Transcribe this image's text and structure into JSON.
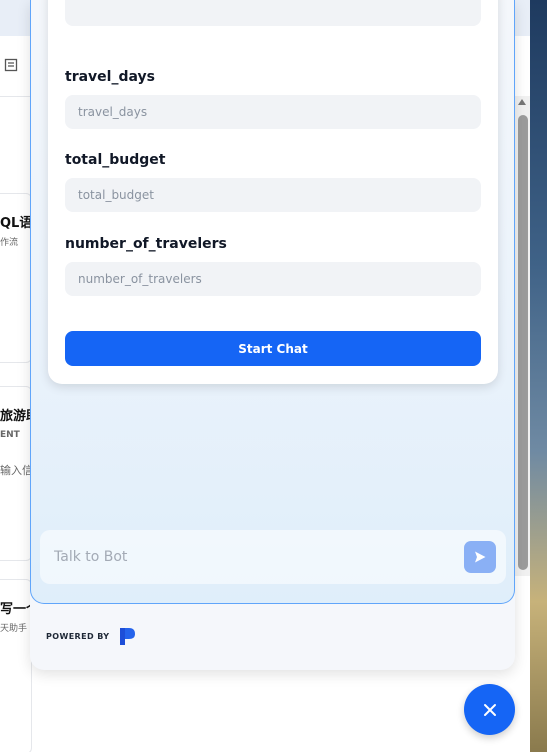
{
  "browser": {
    "icons": [
      "key-icon",
      "star-icon",
      "extensions-icon",
      "profile-icon",
      "menu-icon"
    ]
  },
  "background": {
    "cards": [
      {
        "title": "QL语",
        "sub": "作流"
      },
      {
        "title": "旅游助",
        "sub": "ENT",
        "sub2": "输入信"
      },
      {
        "title": "写一个",
        "sub": "天助手"
      }
    ]
  },
  "form": {
    "fields": [
      {
        "label": "travel_days",
        "placeholder": "travel_days",
        "value": ""
      },
      {
        "label": "total_budget",
        "placeholder": "total_budget",
        "value": ""
      },
      {
        "label": "number_of_travelers",
        "placeholder": "number_of_travelers",
        "value": ""
      }
    ],
    "submit_label": "Start Chat"
  },
  "chat": {
    "input_placeholder": "Talk to Bot",
    "input_value": ""
  },
  "footer": {
    "powered_by": "POWERED BY"
  },
  "colors": {
    "primary": "#1565f5",
    "send_button": "#8ab0f5",
    "widget_border": "#60a5fa"
  }
}
